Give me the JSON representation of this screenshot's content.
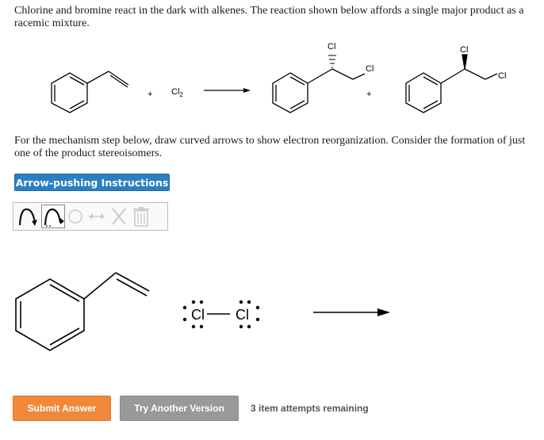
{
  "question": {
    "intro": "Chlorine and bromine react in the dark with alkenes. The reaction shown below affords a single major product as a racemic mixture.",
    "instruction": "For the mechanism step below, draw curved arrows to show electron reorganization. Consider the formation of just one of the product stereoisomers."
  },
  "scheme": {
    "plus1": "+",
    "reagent": "Cl",
    "reagent_sub": "2",
    "plus2": "+",
    "cl_label": "Cl"
  },
  "buttons": {
    "instructions": "Arrow-pushing Instructions",
    "submit": "Submit Answer",
    "try_another": "Try Another Version"
  },
  "status": {
    "attempts": "3 item attempts remaining"
  },
  "canvas": {
    "cl_label": "Cl"
  },
  "colors": {
    "submit": "#f0883a",
    "try_another": "#999999",
    "instructions": "#2b7fc1"
  }
}
